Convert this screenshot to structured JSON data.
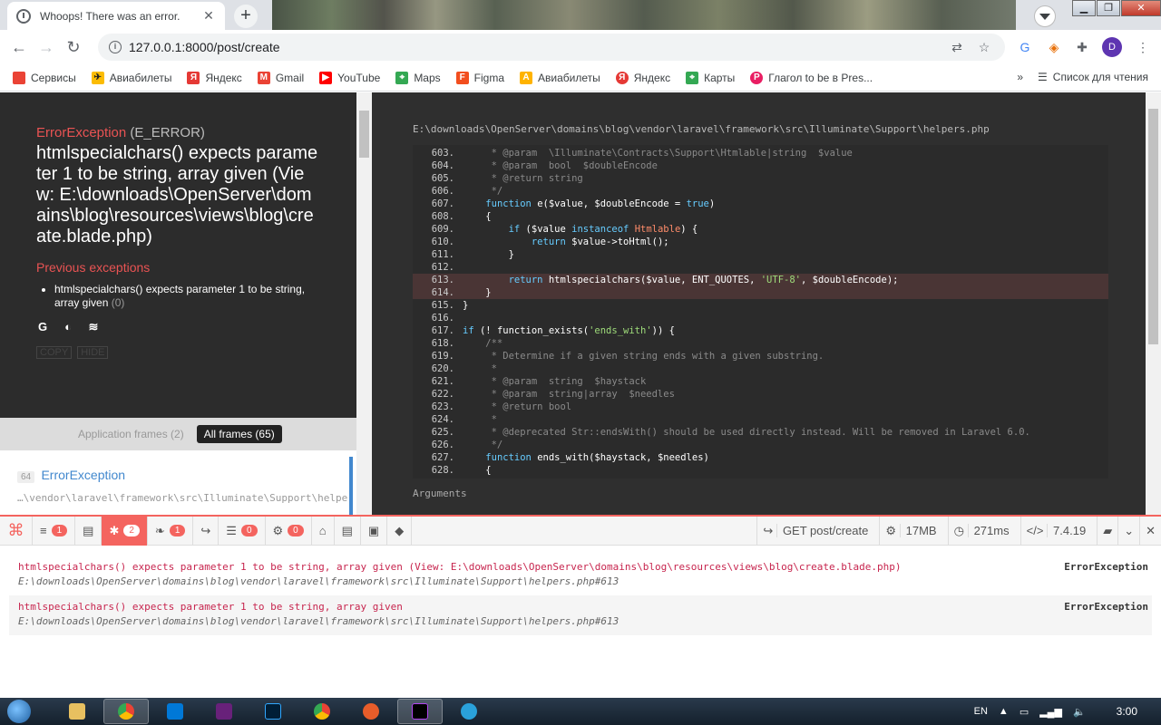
{
  "browser": {
    "tab_title": "Whoops! There was an error.",
    "url": "127.0.0.1:8000/post/create",
    "profile_initial": "D",
    "bookmarks": [
      {
        "label": "Сервисы",
        "color": "#ea4335"
      },
      {
        "label": "Авиабилеты",
        "color": "#222"
      },
      {
        "label": "Яндекс",
        "color": "#e53935"
      },
      {
        "label": "Gmail",
        "color": "#ea4335"
      },
      {
        "label": "YouTube",
        "color": "#ff0000"
      },
      {
        "label": "Maps",
        "color": "#34a853"
      },
      {
        "label": "Figma",
        "color": "#f24e1e"
      },
      {
        "label": "Авиабилеты",
        "color": "#ffb300"
      },
      {
        "label": "Яндекс",
        "color": "#e53935"
      },
      {
        "label": "Карты",
        "color": "#34a853"
      },
      {
        "label": "Глагол to be в Pres...",
        "color": "#e91e63"
      }
    ],
    "reading_list": "Список для чтения",
    "more": "»"
  },
  "error": {
    "class": "ErrorException",
    "code": "(E_ERROR)",
    "message": "htmlspecialchars() expects parameter 1 to be string, array given (View: E:\\downloads\\OpenServer\\domains\\blog\\resources\\views\\blog\\create.blade.php)",
    "previous_title": "Previous exceptions",
    "previous": [
      "htmlspecialchars() expects parameter 1 to be string, array given"
    ],
    "previous_count": "(0)",
    "copy": "COPY",
    "hide": "HIDE"
  },
  "frames": {
    "application": "Application frames (2)",
    "all": "All frames (65)",
    "item_index": "64",
    "item_class": "ErrorException",
    "item_path": "…\\vendor\\laravel\\framework\\src\\Illuminate\\Support\\helpers"
  },
  "code": {
    "file": "E:\\downloads\\OpenServer\\domains\\blog\\vendor\\laravel\\framework\\src\\Illuminate\\Support\\helpers.php",
    "arguments": "Arguments",
    "highlight_line": "613."
  },
  "debugbar": {
    "tabs": [
      {
        "icon": "≡",
        "badge": "1"
      },
      {
        "icon": "▤",
        "badge": ""
      },
      {
        "icon": "✱",
        "badge": "2",
        "active": true
      },
      {
        "icon": "❧",
        "badge": "1"
      },
      {
        "icon": "↪",
        "badge": ""
      },
      {
        "icon": "☰",
        "badge": "0"
      },
      {
        "icon": "⚙",
        "badge": "0"
      },
      {
        "icon": "⌂",
        "badge": ""
      },
      {
        "icon": "▤",
        "badge": ""
      },
      {
        "icon": "▣",
        "badge": ""
      },
      {
        "icon": "◆",
        "badge": ""
      }
    ],
    "route": "GET post/create",
    "memory": "17MB",
    "time": "271ms",
    "php": "7.4.19",
    "rows": [
      {
        "msg": "htmlspecialchars() expects parameter 1 to be string, array given (View: E:\\downloads\\OpenServer\\domains\\blog\\resources\\views\\blog\\create.blade.php)",
        "loc": "E:\\downloads\\OpenServer\\domains\\blog\\vendor\\laravel\\framework\\src\\Illuminate\\Support\\helpers.php#613",
        "label": "ErrorException"
      },
      {
        "msg": "htmlspecialchars() expects parameter 1 to be string, array given",
        "loc": "E:\\downloads\\OpenServer\\domains\\blog\\vendor\\laravel\\framework\\src\\Illuminate\\Support\\helpers.php#613",
        "label": "ErrorException"
      }
    ]
  },
  "taskbar": {
    "apps": [
      "explorer",
      "chrome",
      "vscode",
      "visual-studio",
      "photoshop",
      "chrome-alt",
      "app-orange",
      "phpstorm",
      "telegram"
    ],
    "lang": "EN",
    "clock": "3:00"
  }
}
